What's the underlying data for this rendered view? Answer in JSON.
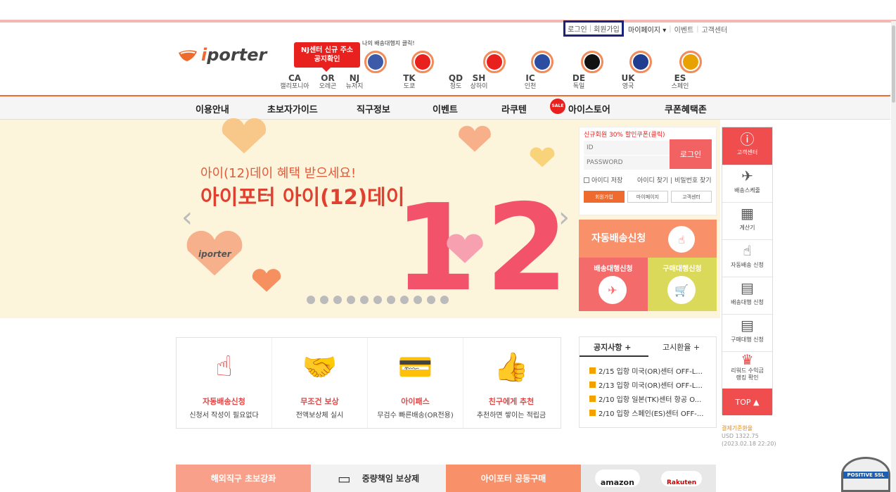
{
  "util": {
    "login": "로그인",
    "join": "회원가입",
    "mypage": "마이페이지",
    "mypage_caret": "▾",
    "event": "이벤트",
    "cs": "고객센터"
  },
  "logo": {
    "brand_i": "i",
    "brand_rest": "porter"
  },
  "notice": {
    "line1": "NJ센터 신규 주소",
    "line2": "공지확인"
  },
  "mydelivery": "나의 배송대행지 클릭!",
  "centers": [
    {
      "code": "CA",
      "name": "캘리포니아"
    },
    {
      "code": "OR",
      "name": "오레곤"
    },
    {
      "code": "NJ",
      "name": "뉴저지"
    },
    {
      "code": "TK",
      "name": "도쿄"
    },
    {
      "code": "QD",
      "name": "청도"
    },
    {
      "code": "SH",
      "name": "상하이"
    },
    {
      "code": "IC",
      "name": "인천"
    },
    {
      "code": "DE",
      "name": "독일"
    },
    {
      "code": "UK",
      "name": "영국"
    },
    {
      "code": "ES",
      "name": "스페인"
    }
  ],
  "nav": [
    "이용안내",
    "초보자가이드",
    "직구정보",
    "이벤트",
    "라쿠텐",
    "아이스토어",
    "쿠폰혜택존"
  ],
  "sale": "SALE",
  "banner": {
    "line1": "아이(12)데이 혜택 받으세요!",
    "line2": "아이포터 아이(12)데이",
    "num1": "1",
    "num2": "2",
    "brand": "iporter",
    "prev": "‹",
    "next": "›"
  },
  "login": {
    "promo": "신규회원 30% 할인쿠폰(클릭)",
    "id": "ID",
    "pw": "PASSWORD",
    "button": "로그인",
    "save": "아이디 저장",
    "find": "아이디 찾기 | 비밀번호 찾기",
    "join": "회원가입",
    "mypage": "마이페이지",
    "cs": "고객센터"
  },
  "auto": {
    "label": "자동배송신청"
  },
  "buy": {
    "delivery": "배송대행신청",
    "purchase": "구매대행신청"
  },
  "side": {
    "items": [
      "고객센터",
      "배송스케줄",
      "계산기",
      "자동배송 신청",
      "배송대행 신청",
      "구매대행 신청",
      "리워드 수익금 랭킹 확인"
    ],
    "top": "TOP ▲"
  },
  "rate": {
    "title": "결제기준환율",
    "usd": "USD 1322.75",
    "date": "(2023.02.18 22:20)"
  },
  "features": [
    {
      "t1": "자동배송신청",
      "t2": "신청서 작성이 필요없다"
    },
    {
      "t1": "무조건 보상",
      "t2": "전액보상체 실시"
    },
    {
      "t1": "아이패스",
      "t2": "무검수 빠른배송(OR전용)"
    },
    {
      "t1": "친구에게 추천",
      "t2": "추천하면 쌓이는 적립금"
    }
  ],
  "news": {
    "tab1": "공지사항 +",
    "tab2": "고시환율 +",
    "items": [
      "2/15 입항 미국(OR)센터 OFF-L...",
      "2/13 입항 미국(OR)센터 OFF-L...",
      "2/10 입항 일본(TK)센터 항공 O...",
      "2/10 입항 스페인(ES)센터 OFF-..."
    ]
  },
  "bottom": {
    "b1": "해외직구 초보강좌",
    "b2": "중량책임 보상제",
    "b3": "아이포터 공동구매",
    "amazon": "amazon",
    "rakuten": "Rakuten"
  },
  "ssl": {
    "line1": "POSITIVE SSL SECURED",
    "line2": "POSITIVE SSL"
  },
  "colors": {
    "accent": "#ee6a2f",
    "red": "#e8211f",
    "pink": "#f26262"
  }
}
